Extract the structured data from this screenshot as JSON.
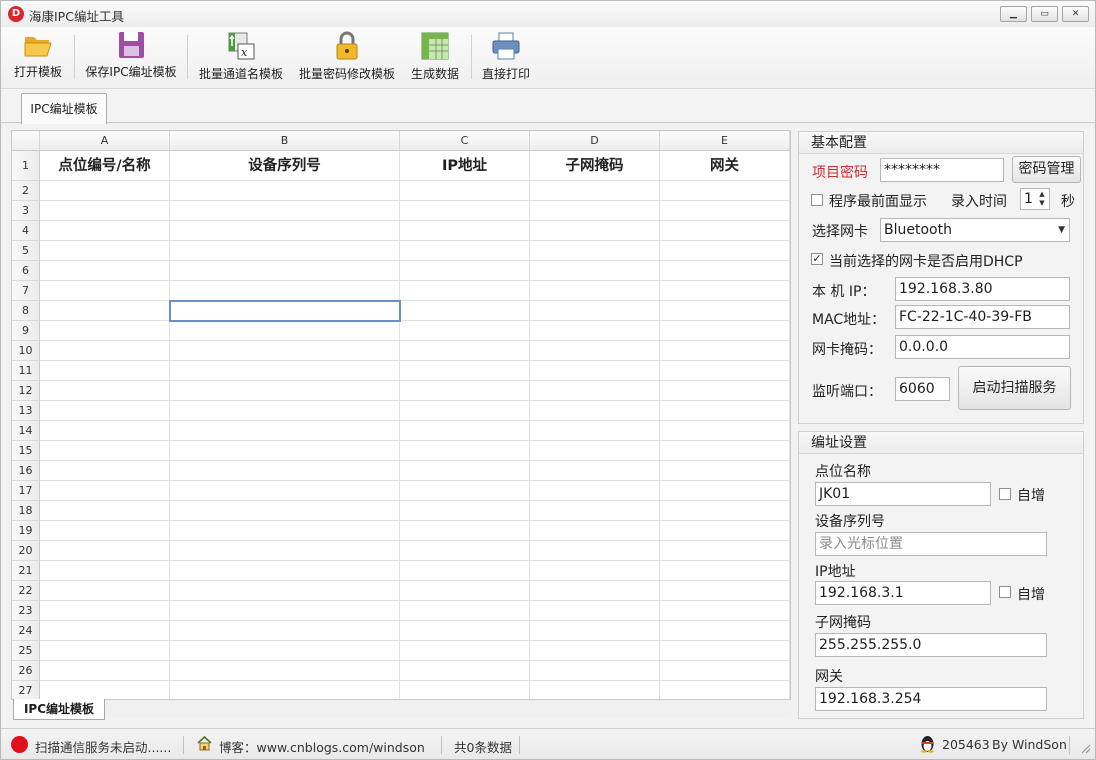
{
  "window": {
    "title": "海康IPC编址工具",
    "icon_letter": "D",
    "minimize": "▁",
    "maximize": "▭",
    "close": "✕"
  },
  "toolbar": {
    "open_template": "打开模板",
    "save_template": "保存IPC编址模板",
    "batch_channel_name": "批量通道名模板",
    "batch_password": "批量密码修改模板",
    "generate_data": "生成数据",
    "print": "直接打印"
  },
  "tabs": {
    "main_tab": "IPC编址模板"
  },
  "sheet": {
    "columns": [
      "A",
      "B",
      "C",
      "D",
      "E"
    ],
    "headers": [
      "点位编号/名称",
      "设备序列号",
      "IP地址",
      "子网掩码",
      "网关"
    ],
    "rows": [
      "1",
      "2",
      "3",
      "4",
      "5",
      "6",
      "7",
      "8",
      "9",
      "10",
      "11",
      "12",
      "13",
      "14",
      "15",
      "16",
      "17",
      "18",
      "19",
      "20",
      "21",
      "22",
      "23",
      "24",
      "25",
      "26",
      "27"
    ],
    "sheet_tab": "IPC编址模板"
  },
  "basic_config": {
    "title": "基本配置",
    "project_password_label": "项目密码",
    "project_password_value": "********",
    "password_manage_button": "密码管理",
    "topmost_label": "程序最前面显示",
    "topmost_checked": false,
    "input_time_label": "录入时间",
    "input_time_value": "1",
    "input_time_unit": "秒",
    "nic_label": "选择网卡",
    "nic_value": "Bluetooth",
    "dhcp_label": "当前选择的网卡是否启用DHCP",
    "dhcp_checked": true,
    "local_ip_label": "本 机 IP：",
    "local_ip_value": "192.168.3.80",
    "mac_label": "MAC地址：",
    "mac_value": "FC-22-1C-40-39-FB",
    "mask_label": "网卡掩码：",
    "mask_value": "0.0.0.0",
    "port_label": "监听端口：",
    "port_value": "6060",
    "start_scan_button": "启动扫描服务"
  },
  "address_settings": {
    "title": "编址设置",
    "point_name_label": "点位名称",
    "point_name_value": "JK01",
    "auto_inc_label": "自增",
    "serial_label": "设备序列号",
    "serial_placeholder": "录入光标位置",
    "ip_label": "IP地址",
    "ip_value": "192.168.3.1",
    "ip_auto_inc_label": "自增",
    "mask_label": "子网掩码",
    "mask_value": "255.255.255.0",
    "gateway_label": "网关",
    "gateway_value": "192.168.3.254"
  },
  "status": {
    "scan_status": "扫描通信服务未启动......",
    "blog": "博客：www.cnblogs.com/windson",
    "data_count": "共0条数据",
    "qq": "205463",
    "author": "By WindSon"
  },
  "colors": {
    "accent_red": "#d62b2b",
    "selection_border": "#6a8fc8",
    "status_dot": "#e0101c"
  }
}
